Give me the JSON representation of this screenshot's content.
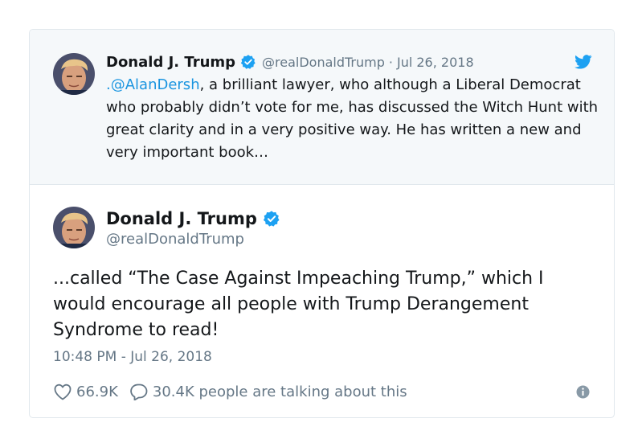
{
  "quoted_tweet": {
    "author_name": "Donald J. Trump",
    "handle": "@realDonaldTrump",
    "separator": "·",
    "date": "Jul 26, 2018",
    "mention": ".@AlanDersh",
    "text": ", a brilliant lawyer, who although a Liberal Democrat who probably didn’t vote for me, has discussed the Witch Hunt with great clarity and in a very positive way. He has written a new and very important book…",
    "icons": [
      "verified-badge-icon",
      "twitter-bird-icon",
      "avatar"
    ]
  },
  "main_tweet": {
    "author_name": "Donald J. Trump",
    "handle": "@realDonaldTrump",
    "text": "...called “The Case Against Impeaching Trump,” which I would encourage all people with Trump Derangement Syndrome to read!",
    "timestamp": "10:48 PM - Jul 26, 2018",
    "likes": "66.9K",
    "talking": "30.4K people are talking about this",
    "icons": [
      "heart-icon",
      "reply-bubble-icon",
      "info-icon",
      "verified-badge-icon",
      "avatar"
    ]
  },
  "colors": {
    "link": "#1b95e0",
    "verified": "#1da1f2",
    "muted": "#657786",
    "text": "#14171a",
    "quoted_bg": "#f5f8fa",
    "border": "#e1e8ed"
  }
}
